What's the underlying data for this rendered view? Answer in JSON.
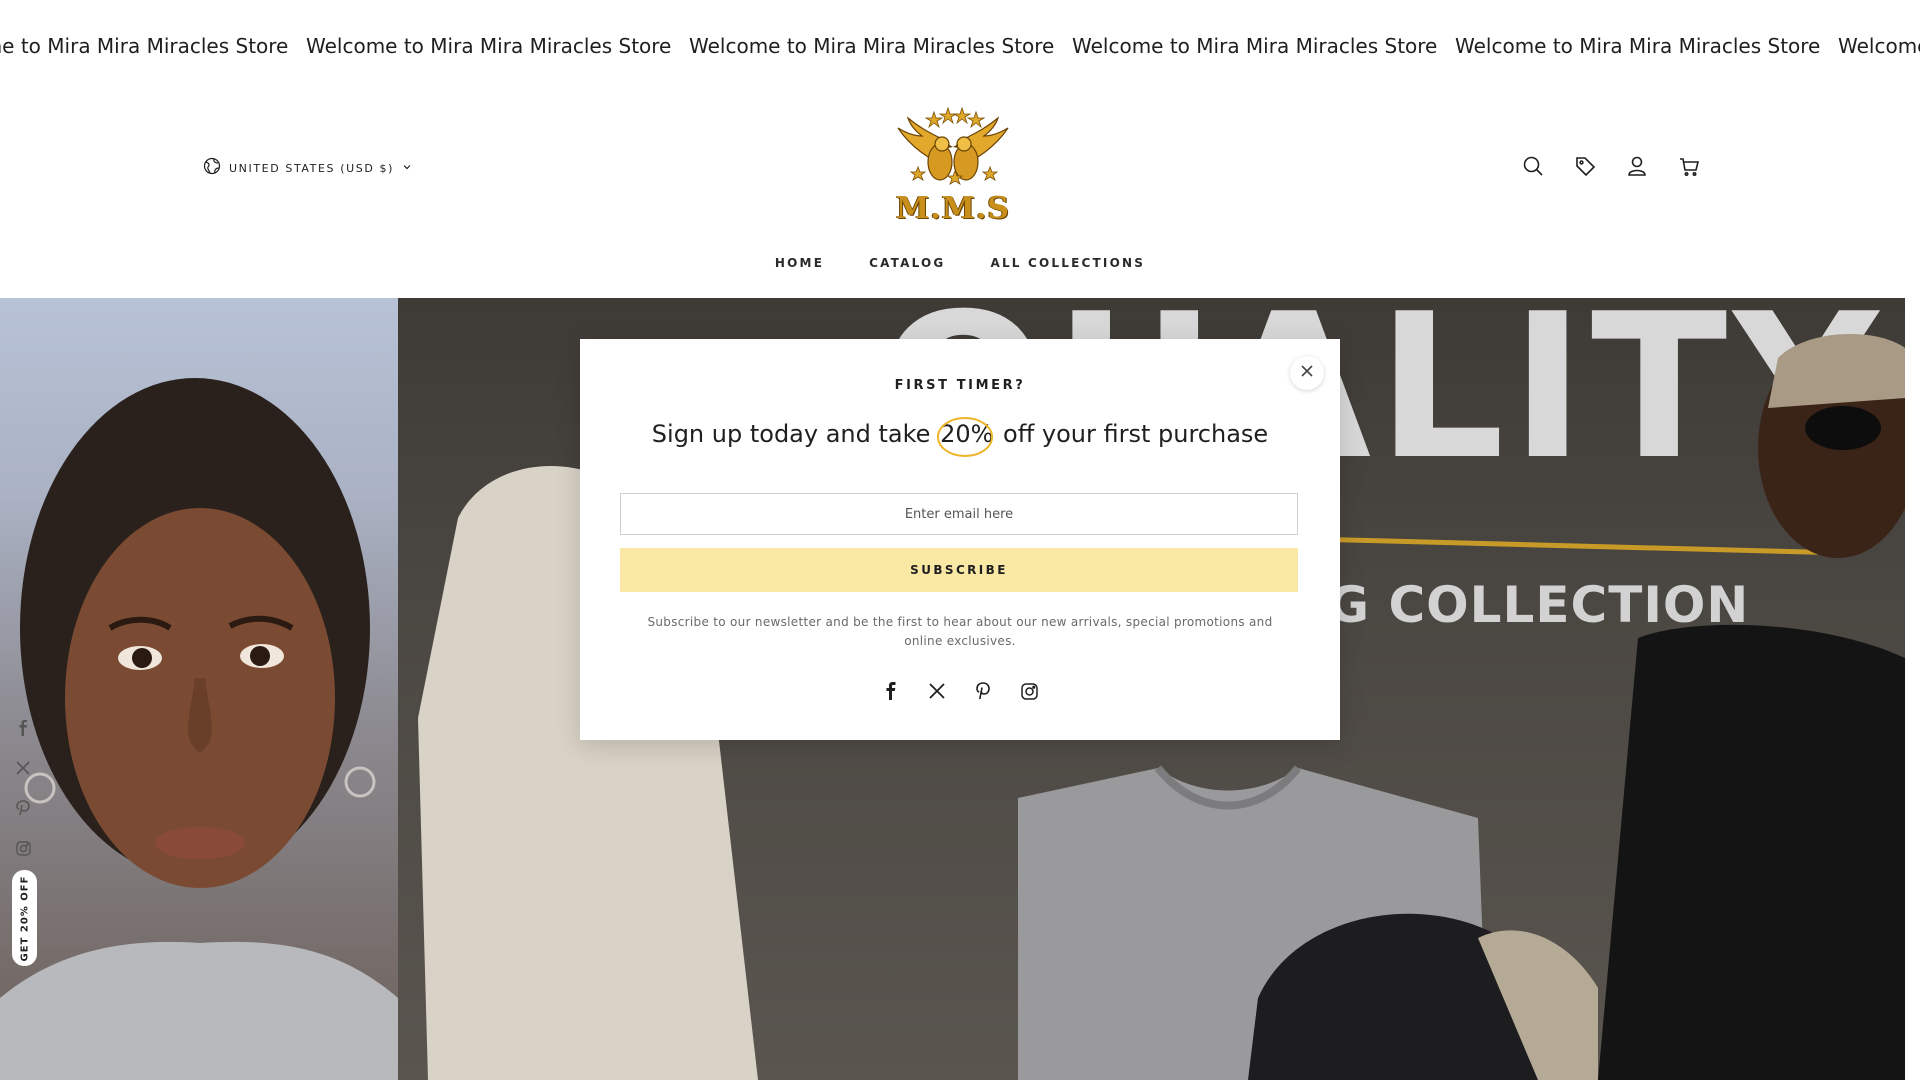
{
  "announcement": {
    "items": [
      "Welcome to Mira Mira Miracles Store",
      "Welcome to Mira Mira Miracles Store",
      "Welcome to Mira Mira Miracles Store",
      "Welcome to Mira Mira Miracles Store",
      "Welcome to Mira Mira Miracles Store",
      "Welcome to Mira Mira Miracles Store"
    ]
  },
  "header": {
    "country_selector": "UNITED STATES (USD $)",
    "logo_text": "M.M.S",
    "icons": [
      "search-icon",
      "tag-icon",
      "account-icon",
      "cart-icon"
    ]
  },
  "nav": {
    "items": [
      "HOME",
      "CATALOG",
      "ALL COLLECTIONS"
    ]
  },
  "hero": {
    "bg_text": "QUALITY",
    "sub_text": "G COLLECTION"
  },
  "side_tab": {
    "label": "GET 20% OFF",
    "social_icons": [
      "facebook-icon",
      "x-icon",
      "pinterest-icon",
      "instagram-icon"
    ]
  },
  "popup": {
    "kicker": "FIRST TIMER?",
    "heading_before": "Sign up today and take",
    "heading_highlight": "20%",
    "heading_after": "off your first purchase",
    "email_placeholder": "Enter email here",
    "subscribe_label": "SUBSCRIBE",
    "note": "Subscribe to our newsletter and be the first to hear about our new arrivals, special promotions and online exclusives.",
    "social_icons": [
      "facebook-icon",
      "x-icon",
      "pinterest-icon",
      "instagram-icon"
    ]
  },
  "colors": {
    "accent_gold": "#f0b429",
    "subscribe_bg": "#f9e9a4",
    "logo_gold": "#c8901a"
  }
}
